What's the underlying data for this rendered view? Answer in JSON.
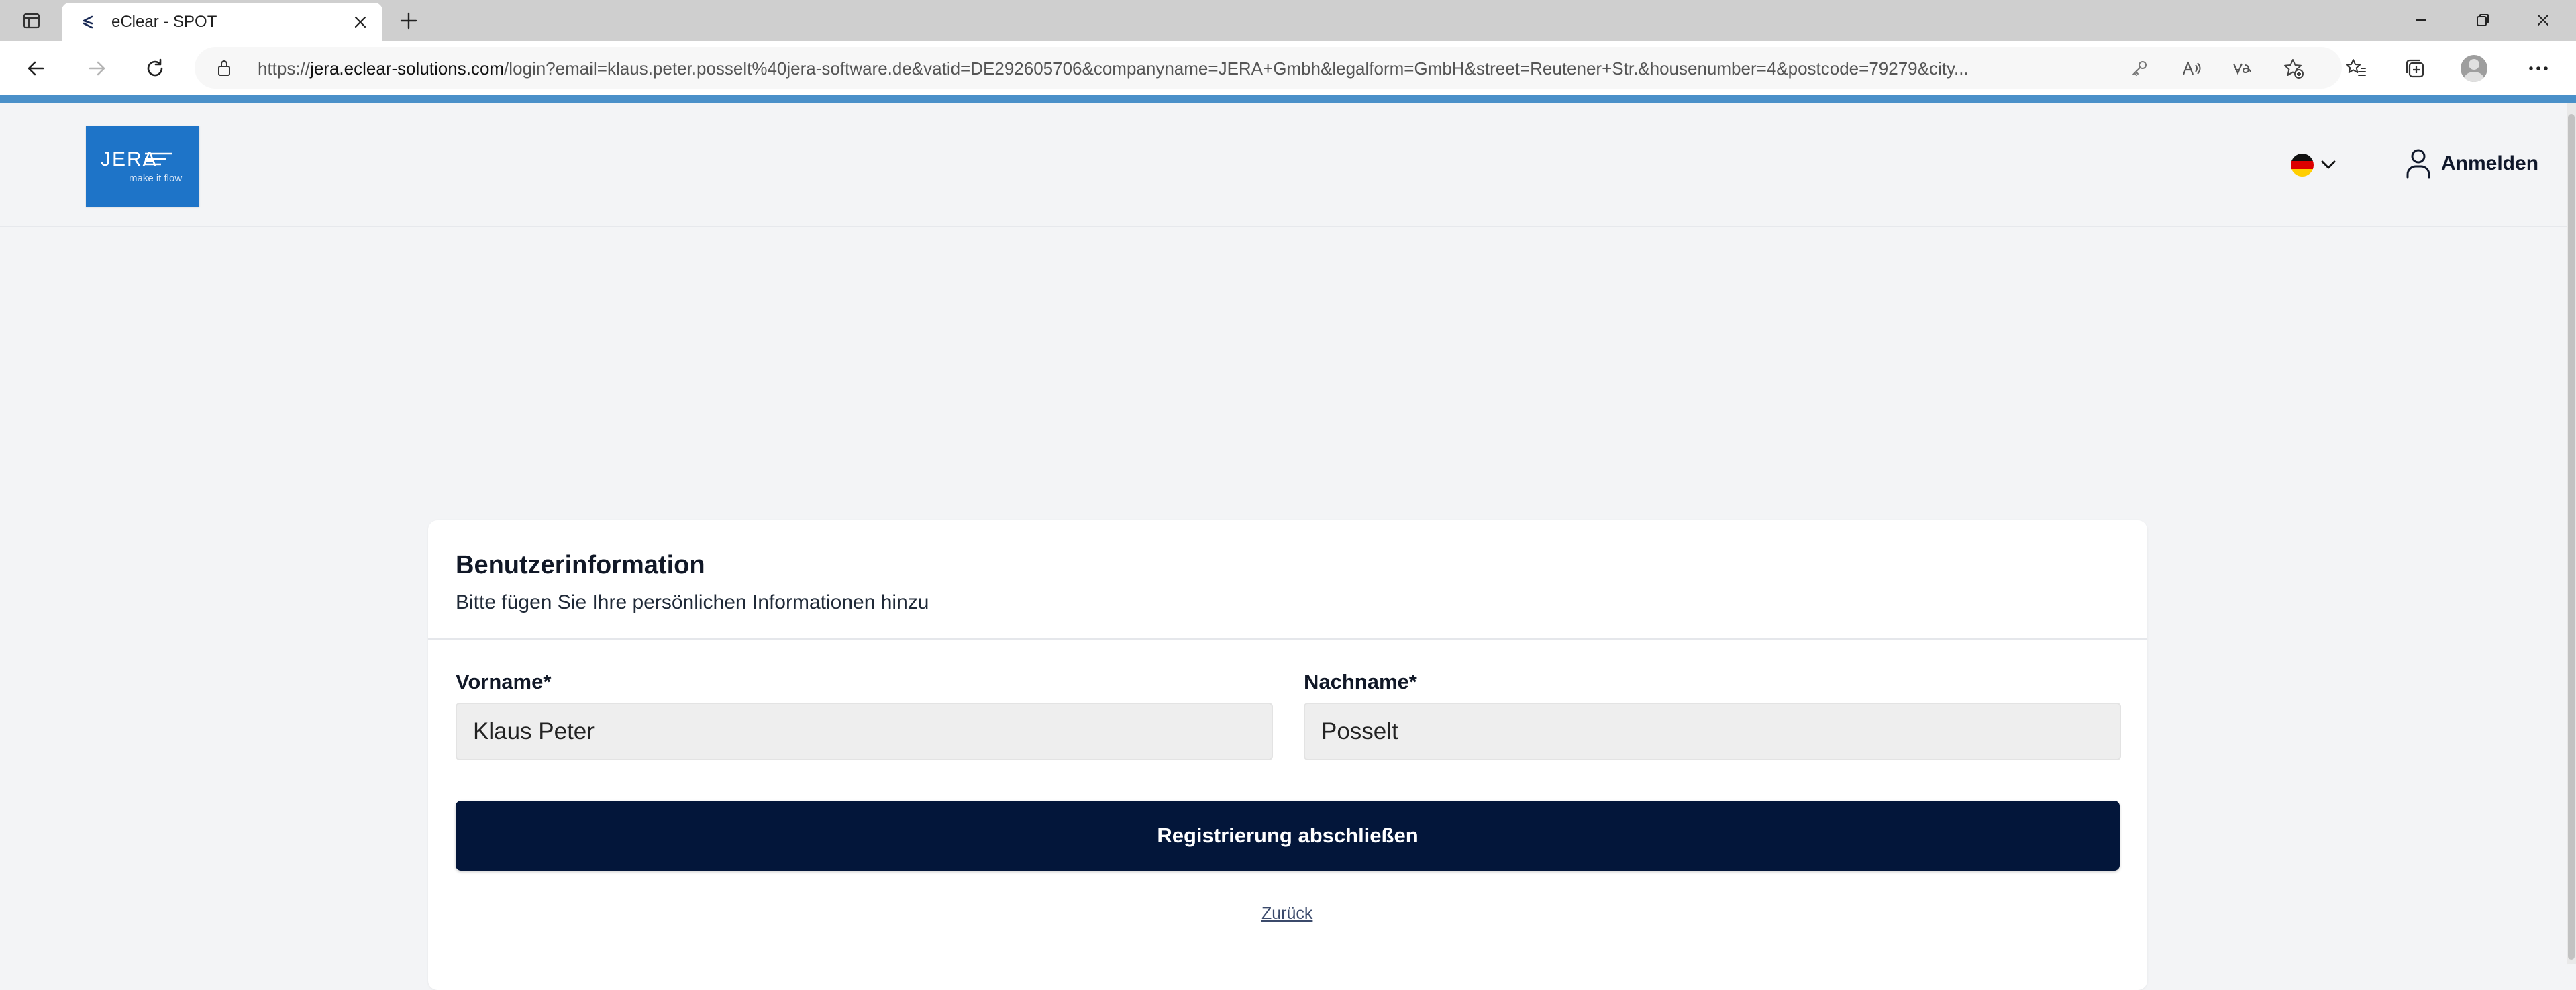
{
  "browser": {
    "tab_title": "eClear - SPOT",
    "url_prefix": "https://",
    "url_host": "jera.eclear-solutions.com",
    "url_rest": "/login?email=klaus.peter.posselt%40jera-software.de&vatid=DE292605706&companyname=JERA+Gmbh&legalform=GmbH&street=Reutener+Str.&housenumber=4&postcode=79279&city..."
  },
  "header": {
    "logo_word": "JERA",
    "logo_tagline": "make it flow",
    "login_label": "Anmelden"
  },
  "form": {
    "title": "Benutzerinformation",
    "subtitle": "Bitte fügen Sie Ihre persönlichen Informationen hinzu",
    "first_name_label": "Vorname*",
    "first_name_value": "Klaus Peter",
    "last_name_label": "Nachname*",
    "last_name_value": "Posselt",
    "submit_label": "Registrierung abschließen",
    "back_label": "Zurück"
  },
  "colors": {
    "accent": "#4a90c9",
    "logo": "#1e74c8",
    "primary_button": "#03163a"
  }
}
